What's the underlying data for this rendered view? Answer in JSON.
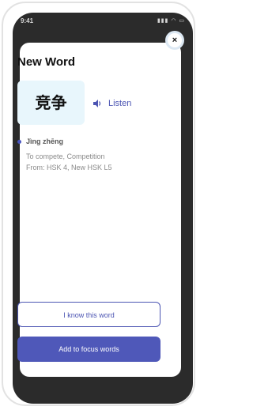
{
  "status": {
    "time": "9:41",
    "icons": "▮▮▮ ◠ ▭"
  },
  "modal": {
    "title": "New Word",
    "close_label": "×",
    "hanzi": "竞争",
    "listen_label": "Listen",
    "pinyin": "Jìng zhēng",
    "meaning": "To compete, Competition",
    "source": "From: HSK 4, New HSK L5",
    "know_button": "I know this word",
    "focus_button": "Add to focus words"
  },
  "colors": {
    "accent": "#4f58b9",
    "card_bg": "#e8f6fc",
    "screen_bg": "#2b2b2b"
  },
  "icons": [
    "close-icon",
    "speaker-icon",
    "bullet-dot-icon"
  ]
}
